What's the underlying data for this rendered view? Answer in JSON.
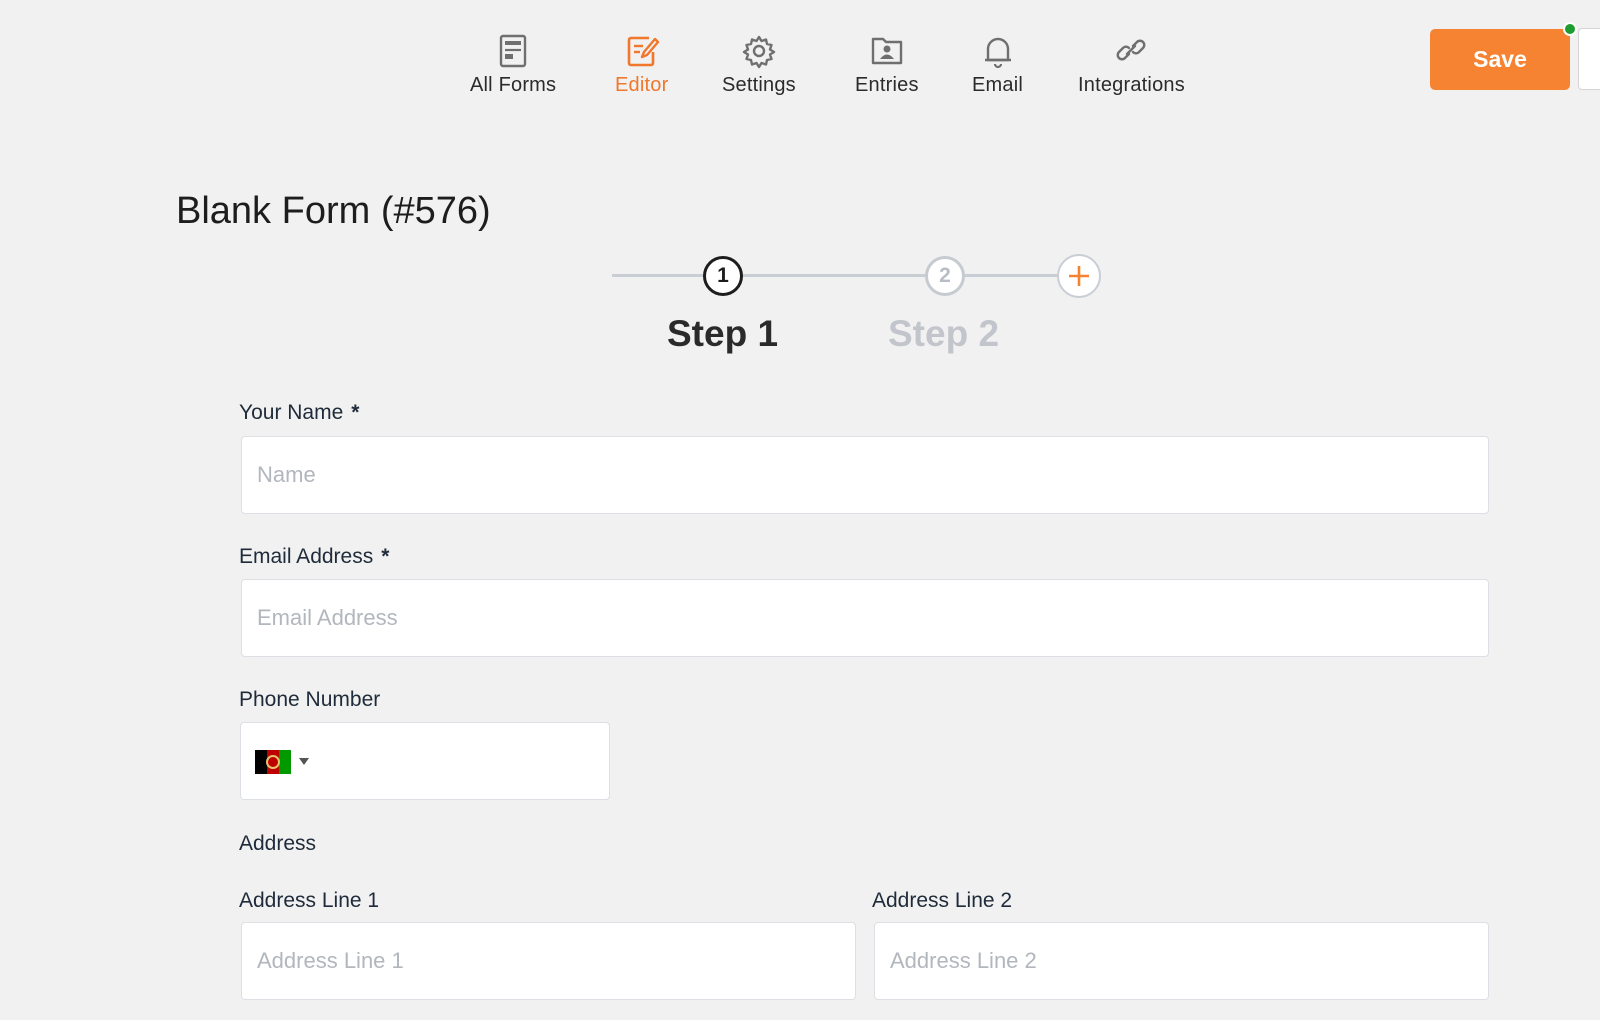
{
  "nav": {
    "items": [
      {
        "label": "All Forms",
        "icon": "forms-list-icon",
        "active": false
      },
      {
        "label": "Editor",
        "icon": "editor-icon",
        "active": true
      },
      {
        "label": "Settings",
        "icon": "gear-icon",
        "active": false
      },
      {
        "label": "Entries",
        "icon": "entries-icon",
        "active": false
      },
      {
        "label": "Email",
        "icon": "bell-icon",
        "active": false
      },
      {
        "label": "Integrations",
        "icon": "link-icon",
        "active": false
      }
    ],
    "save_label": "Save"
  },
  "colors": {
    "accent": "#f58332",
    "active_nav": "#f0772c",
    "status_online": "#1e9c2f",
    "step_inactive": "#c2c6cc"
  },
  "form": {
    "title": "Blank Form (#576)",
    "steps": [
      {
        "number": "1",
        "label": "Step 1",
        "current": true
      },
      {
        "number": "2",
        "label": "Step 2",
        "current": false
      }
    ],
    "add_step_symbol": "+",
    "fields": {
      "name": {
        "label": "Your Name",
        "required_mark": "*",
        "placeholder": "Name"
      },
      "email": {
        "label": "Email Address",
        "required_mark": "*",
        "placeholder": "Email Address"
      },
      "phone": {
        "label": "Phone Number",
        "country_flag": "afghanistan-flag-icon"
      },
      "address": {
        "section_label": "Address",
        "line1": {
          "label": "Address Line 1",
          "placeholder": "Address Line 1"
        },
        "line2": {
          "label": "Address Line 2",
          "placeholder": "Address Line 2"
        }
      }
    }
  }
}
